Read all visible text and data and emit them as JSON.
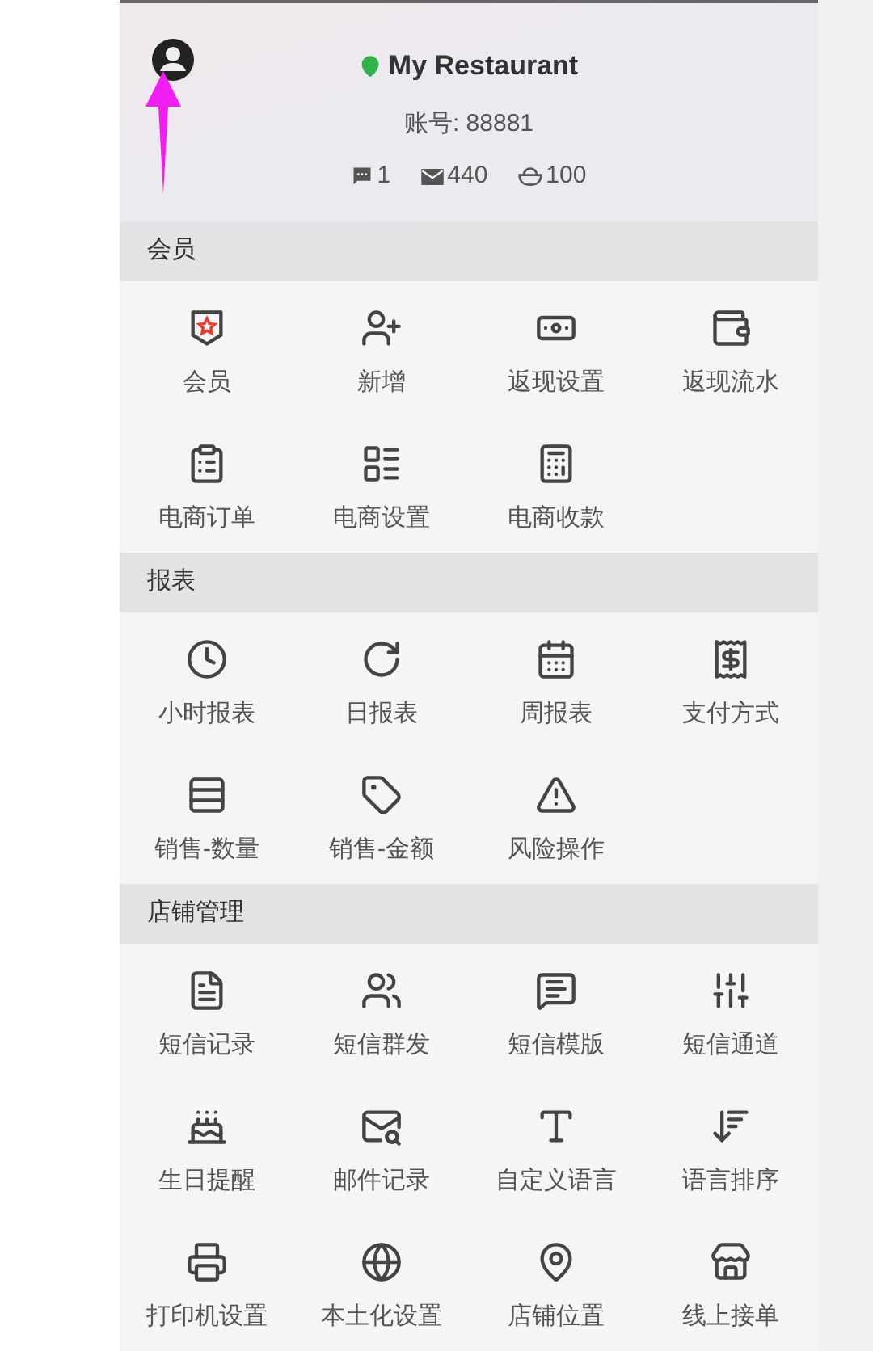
{
  "header": {
    "store_name": "My Restaurant",
    "account": "账号: 88881",
    "stats": [
      {
        "value": "1"
      },
      {
        "value": "440"
      },
      {
        "value": "100"
      }
    ]
  },
  "sections": [
    {
      "title": "会员",
      "items": [
        {
          "label": "会员"
        },
        {
          "label": "新增"
        },
        {
          "label": "返现设置"
        },
        {
          "label": "返现流水"
        },
        {
          "label": "电商订单"
        },
        {
          "label": "电商设置"
        },
        {
          "label": "电商收款"
        }
      ]
    },
    {
      "title": "报表",
      "items": [
        {
          "label": "小时报表"
        },
        {
          "label": "日报表"
        },
        {
          "label": "周报表"
        },
        {
          "label": "支付方式"
        },
        {
          "label": "销售-数量"
        },
        {
          "label": "销售-金额"
        },
        {
          "label": "风险操作"
        }
      ]
    },
    {
      "title": "店铺管理",
      "items": [
        {
          "label": "短信记录"
        },
        {
          "label": "短信群发"
        },
        {
          "label": "短信模版"
        },
        {
          "label": "短信通道"
        },
        {
          "label": "生日提醒"
        },
        {
          "label": "邮件记录"
        },
        {
          "label": "自定义语言"
        },
        {
          "label": "语言排序"
        },
        {
          "label": "打印机设置"
        },
        {
          "label": "本土化设置"
        },
        {
          "label": "店铺位置"
        },
        {
          "label": "线上接单"
        }
      ]
    }
  ]
}
